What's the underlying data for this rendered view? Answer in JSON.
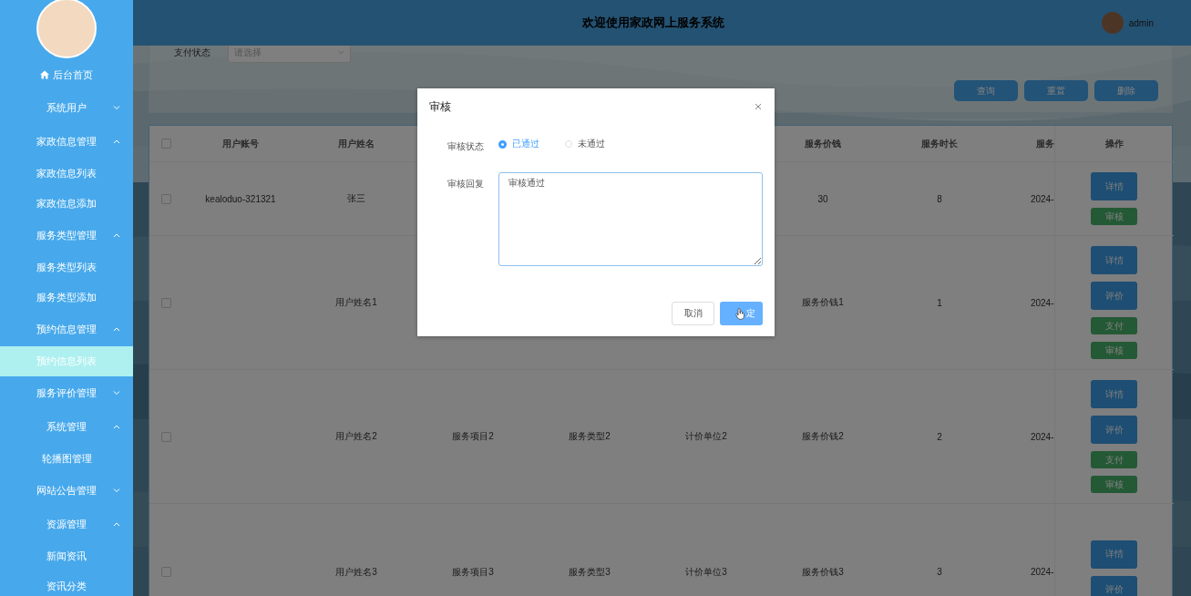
{
  "sidebar": {
    "items": [
      {
        "label": "后台首页",
        "kind": "home"
      },
      {
        "label": "系统用户",
        "kind": "group",
        "expanded": false
      },
      {
        "label": "家政信息管理",
        "kind": "group",
        "expanded": true,
        "children": [
          {
            "label": "家政信息列表",
            "selected": false
          },
          {
            "label": "家政信息添加",
            "selected": false
          }
        ]
      },
      {
        "label": "服务类型管理",
        "kind": "group",
        "expanded": true,
        "children": [
          {
            "label": "服务类型列表",
            "selected": false
          },
          {
            "label": "服务类型添加",
            "selected": false
          }
        ]
      },
      {
        "label": "预约信息管理",
        "kind": "group",
        "expanded": true,
        "children": [
          {
            "label": "预约信息列表",
            "selected": true
          }
        ]
      },
      {
        "label": "服务评价管理",
        "kind": "group",
        "expanded": false
      },
      {
        "label": "系统管理",
        "kind": "group",
        "expanded": true,
        "children": [
          {
            "label": "轮播图管理",
            "selected": false
          }
        ]
      },
      {
        "label": "网站公告管理",
        "kind": "group",
        "expanded": false
      },
      {
        "label": "资源管理",
        "kind": "group",
        "expanded": true,
        "children": [
          {
            "label": "新闻资讯",
            "selected": false
          },
          {
            "label": "资讯分类",
            "selected": false
          }
        ]
      }
    ]
  },
  "header": {
    "title": "欢迎使用家政网上服务系统",
    "user": "admin"
  },
  "search": {
    "label": "支付状态",
    "placeholder": "请选择",
    "buttons": [
      "查询",
      "重置",
      "删除"
    ]
  },
  "table": {
    "all_checked": false,
    "columns": [
      "用户账号",
      "用户姓名",
      null,
      null,
      null,
      "服务价钱",
      "服务时长",
      "服务",
      "操作"
    ],
    "rows": [
      {
        "checked": false,
        "cells": [
          "kealoduo-321321",
          "张三",
          null,
          null,
          null,
          "30",
          "8",
          "2024-"
        ],
        "actions": [
          {
            "label": "详情",
            "kind": "primary"
          },
          {
            "label": "审核",
            "kind": "success"
          }
        ]
      },
      {
        "checked": false,
        "cells": [
          null,
          "用户姓名1",
          null,
          null,
          null,
          "服务价钱1",
          "1",
          "2024-"
        ],
        "actions": [
          {
            "label": "详情",
            "kind": "primary"
          },
          {
            "label": "评价",
            "kind": "primary"
          },
          {
            "label": "支付",
            "kind": "success"
          },
          {
            "label": "审核",
            "kind": "success"
          }
        ]
      },
      {
        "checked": false,
        "cells": [
          null,
          "用户姓名2",
          "服务项目2",
          "服务类型2",
          "计价单位2",
          "服务价钱2",
          "2",
          "2024-"
        ],
        "actions": [
          {
            "label": "详情",
            "kind": "primary"
          },
          {
            "label": "评价",
            "kind": "primary"
          },
          {
            "label": "支付",
            "kind": "success"
          },
          {
            "label": "审核",
            "kind": "success"
          }
        ]
      },
      {
        "checked": false,
        "cells": [
          null,
          "用户姓名3",
          "服务项目3",
          "服务类型3",
          "计价单位3",
          "服务价钱3",
          "3",
          "2024-"
        ],
        "actions": [
          {
            "label": "详情",
            "kind": "primary"
          },
          {
            "label": "评价",
            "kind": "primary"
          }
        ]
      }
    ]
  },
  "dialog": {
    "title": "审核",
    "status_label": "审核状态",
    "options": [
      {
        "label": "已通过",
        "selected": true
      },
      {
        "label": "未通过",
        "selected": false
      }
    ],
    "reply_label": "审核回复",
    "reply": "审核通过",
    "cancel": "取消",
    "confirm": "定"
  }
}
